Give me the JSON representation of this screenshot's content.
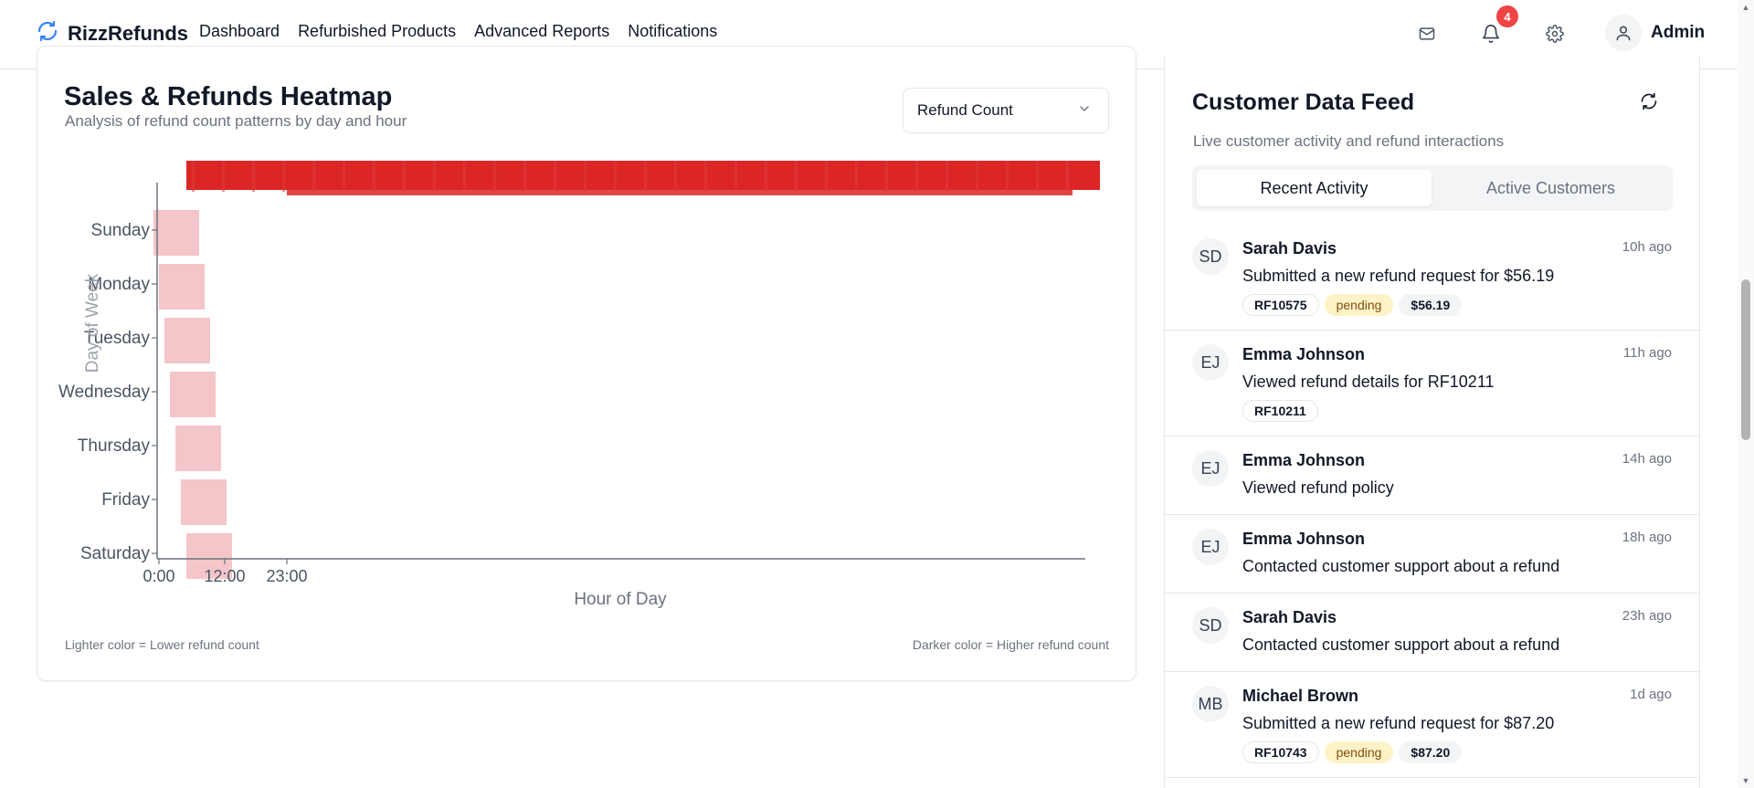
{
  "header": {
    "brand": "RizzRefunds",
    "nav": [
      "Dashboard",
      "Refurbished Products",
      "Advanced Reports",
      "Notifications"
    ],
    "notification_count": "4",
    "user": "Admin",
    "icons": [
      "refresh-logo-icon",
      "mail-icon",
      "bell-icon",
      "settings-gear-icon",
      "user-icon"
    ]
  },
  "heatmap": {
    "title": "Sales & Refunds Heatmap",
    "subtitle": "Analysis of refund count patterns by day and hour",
    "metric_select": "Refund Count",
    "legend_low": "Lighter color = Lower refund count",
    "legend_high": "Darker color = Higher refund count"
  },
  "chart_data": {
    "type": "heatmap",
    "xlabel": "Hour of Day",
    "ylabel": "Day of Week",
    "y_categories": [
      "Sunday",
      "Monday",
      "Tuesday",
      "Wednesday",
      "Thursday",
      "Friday",
      "Saturday"
    ],
    "x_tick_labels": [
      "0:00",
      "12:00",
      "23:00"
    ],
    "colors": {
      "low": "#f5c6c9",
      "high": "#dc2626"
    },
    "cells": [
      {
        "day": "Sunday",
        "level": "low"
      },
      {
        "day": "Monday",
        "level": "low"
      },
      {
        "day": "Tuesday",
        "level": "low"
      },
      {
        "day": "Wednesday",
        "level": "low"
      },
      {
        "day": "Thursday",
        "level": "low"
      },
      {
        "day": "Friday",
        "level": "low"
      },
      {
        "day": "Saturday",
        "level": "low"
      }
    ]
  },
  "feed": {
    "title": "Customer Data Feed",
    "subtitle": "Live customer activity and refund interactions",
    "tabs": [
      "Recent Activity",
      "Active Customers"
    ],
    "items": [
      {
        "initials": "SD",
        "name": "Sarah Davis",
        "time": "10h ago",
        "desc": "Submitted a new refund request for $56.19",
        "tags": [
          "RF10575",
          "pending",
          "$56.19"
        ]
      },
      {
        "initials": "EJ",
        "name": "Emma Johnson",
        "time": "11h ago",
        "desc": "Viewed refund details for RF10211",
        "tags": [
          "RF10211"
        ]
      },
      {
        "initials": "EJ",
        "name": "Emma Johnson",
        "time": "14h ago",
        "desc": "Viewed refund policy",
        "tags": []
      },
      {
        "initials": "EJ",
        "name": "Emma Johnson",
        "time": "18h ago",
        "desc": "Contacted customer support about a refund",
        "tags": []
      },
      {
        "initials": "SD",
        "name": "Sarah Davis",
        "time": "23h ago",
        "desc": "Contacted customer support about a refund",
        "tags": []
      },
      {
        "initials": "MB",
        "name": "Michael Brown",
        "time": "1d ago",
        "desc": "Submitted a new refund request for $87.20",
        "tags": [
          "RF10743",
          "pending",
          "$87.20"
        ]
      }
    ]
  }
}
